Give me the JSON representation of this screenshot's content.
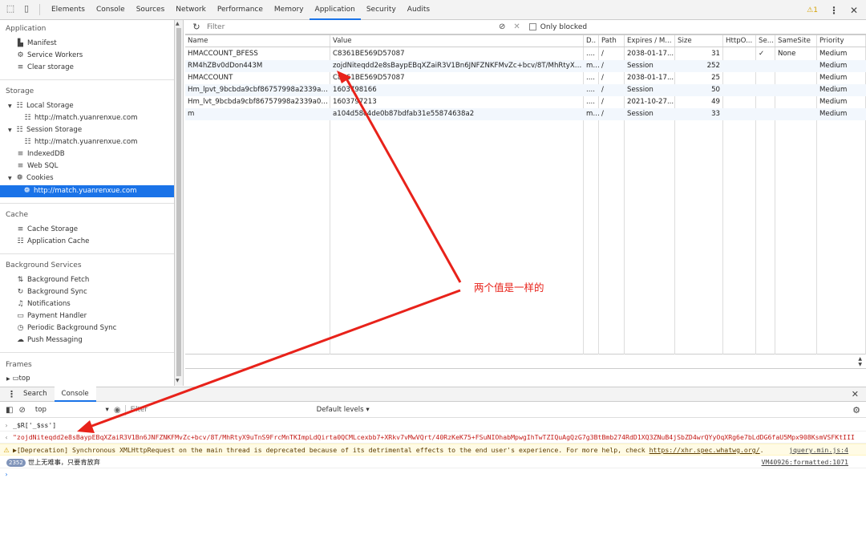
{
  "topbar": {
    "tabs": [
      "Elements",
      "Console",
      "Sources",
      "Network",
      "Performance",
      "Memory",
      "Application",
      "Security",
      "Audits"
    ],
    "active_tab": "Application",
    "warning_count": "1"
  },
  "sidebar": {
    "application_title": "Application",
    "application_items": [
      {
        "icon": "manifest-icon",
        "label": "Manifest"
      },
      {
        "icon": "gear-icon",
        "label": "Service Workers"
      },
      {
        "icon": "database-icon",
        "label": "Clear storage"
      }
    ],
    "storage_title": "Storage",
    "local_storage": "Local Storage",
    "local_storage_child": "http://match.yuanrenxue.com",
    "session_storage": "Session Storage",
    "session_storage_child": "http://match.yuanrenxue.com",
    "indexeddb": "IndexedDB",
    "websql": "Web SQL",
    "cookies": "Cookies",
    "cookies_child": "http://match.yuanrenxue.com",
    "cache_title": "Cache",
    "cache_storage": "Cache Storage",
    "application_cache": "Application Cache",
    "bg_title": "Background Services",
    "bg_items": [
      "Background Fetch",
      "Background Sync",
      "Notifications",
      "Payment Handler",
      "Periodic Background Sync",
      "Push Messaging"
    ],
    "frames_title": "Frames",
    "frames_top": "top"
  },
  "cookies": {
    "filter_placeholder": "Filter",
    "only_blocked": "Only blocked",
    "columns": [
      "Name",
      "Value",
      "D..",
      "Path",
      "Expires / M...",
      "Size",
      "HttpO...",
      "Se...",
      "SameSite",
      "Priority"
    ],
    "rows": [
      {
        "name": "HMACCOUNT_BFESS",
        "value": "C8361BE569D57087",
        "domain": "....",
        "path": "/",
        "expires": "2038-01-17...",
        "size": "31",
        "httponly": "",
        "secure": "✓",
        "samesite": "None",
        "priority": "Medium"
      },
      {
        "name": "RM4hZBv0dDon443M",
        "value": "zojdNiteqdd2e8sBaypEBqXZaiR3V1Bn6JNFZNKFMvZc+bcv/8T/MhRtyX9uTn...",
        "domain": "m...",
        "path": "/",
        "expires": "Session",
        "size": "252",
        "httponly": "",
        "secure": "",
        "samesite": "",
        "priority": "Medium"
      },
      {
        "name": "HMACCOUNT",
        "value": "C8361BE569D57087",
        "domain": "....",
        "path": "/",
        "expires": "2038-01-17...",
        "size": "25",
        "httponly": "",
        "secure": "",
        "samesite": "",
        "priority": "Medium"
      },
      {
        "name": "Hm_lpvt_9bcbda9cbf86757998a2339a0...",
        "value": "1603798166",
        "domain": "....",
        "path": "/",
        "expires": "Session",
        "size": "50",
        "httponly": "",
        "secure": "",
        "samesite": "",
        "priority": "Medium"
      },
      {
        "name": "Hm_lvt_9bcbda9cbf86757998a2339a04...",
        "value": "1603797213",
        "domain": "....",
        "path": "/",
        "expires": "2021-10-27...",
        "size": "49",
        "httponly": "",
        "secure": "",
        "samesite": "",
        "priority": "Medium"
      },
      {
        "name": "m",
        "value": "a104d58c4de0b87bdfab31e55874638a2",
        "domain": "m...",
        "path": "/",
        "expires": "Session",
        "size": "33",
        "httponly": "",
        "secure": "",
        "samesite": "",
        "priority": "Medium"
      }
    ]
  },
  "drawer": {
    "tabs": [
      "Search",
      "Console"
    ],
    "active_tab": "Console"
  },
  "console": {
    "context": "top",
    "filter_placeholder": "Filter",
    "levels": "Default levels ▾",
    "input_line": "_$R['_$ss']",
    "output_line": "\"zojdNiteqdd2e8sBaypEBqXZaiR3V1Bn6JNFZNKFMvZc+bcv/8T/MhRtyX9uTnS9FrcMnTKImpLdQirta0QCMLcexbb7+XRkv7vMwVQrt/40RzKeK75+FSuNIOhabMpwgIhTwTZIQuAgQzG7g3BtBmb274RdD1XQ3ZNuB4jSbZD4wrQYyOqXRg6e7bLdDG6faU5Mpx908KsmVSFKtIII",
    "warning_line": "▶[Deprecation] Synchronous XMLHttpRequest on the main thread is deprecated because of its detrimental effects to the end user's experience. For more help, check",
    "warning_link": "https://xhr.spec.whatwg.org/",
    "warning_link_tail": ".",
    "warning_source": "jquery.min.js:4",
    "log_count": "2352",
    "log_text": "世上无难事，只要肯放弃",
    "log_source": "VM40926:formatted:1071"
  },
  "annotation": {
    "text": "两个值是一样的",
    "color": "#e8221a"
  }
}
